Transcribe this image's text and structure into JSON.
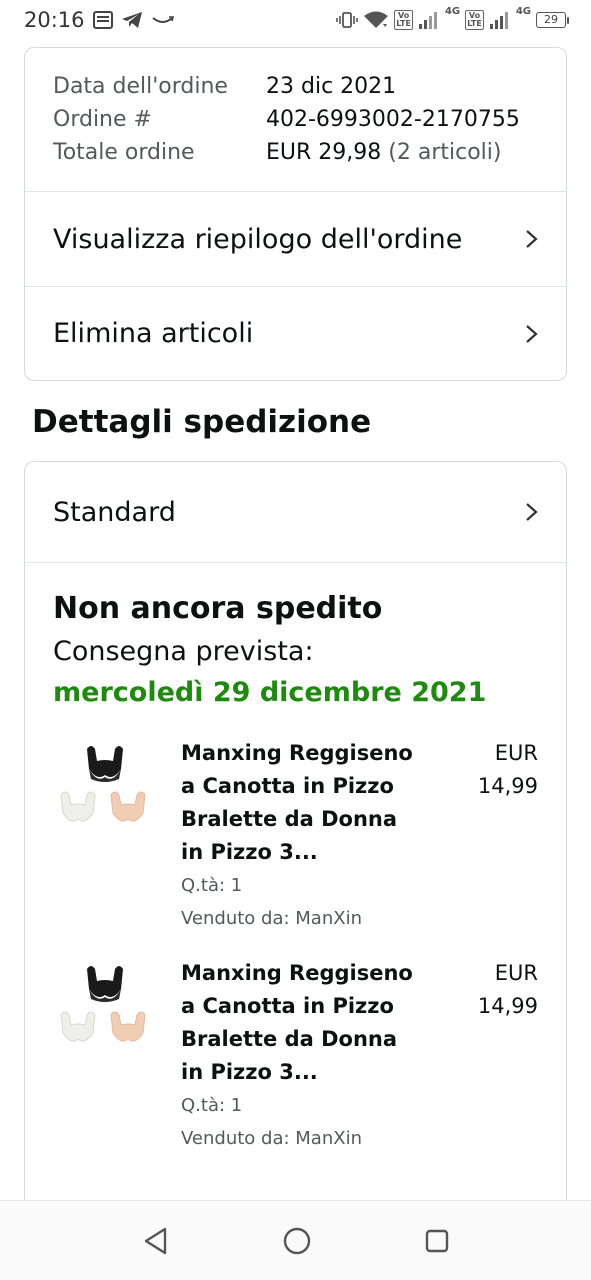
{
  "status_bar": {
    "time": "20:16",
    "icons_left": [
      "message-icon",
      "telegram-icon",
      "amazon-smile-icon"
    ],
    "icons_right": [
      "vibrate-icon",
      "wifi-icon",
      "volte-icon",
      "signal-icon",
      "4g-icon",
      "volte-icon",
      "signal-icon",
      "4g-icon",
      "battery-icon"
    ],
    "volte_label": "Vo LTE",
    "network_label": "4G",
    "battery": "29"
  },
  "order": {
    "date_label": "Data dell'ordine",
    "date_value": "23 dic 2021",
    "number_label": "Ordine #",
    "number_value": "402-6993002-2170755",
    "total_label": "Totale ordine",
    "total_value": "EUR 29,98",
    "total_items": "(2 articoli)",
    "view_summary": "Visualizza riepilogo dell'ordine",
    "delete_items": "Elimina articoli"
  },
  "shipping": {
    "section_title": "Dettagli spedizione",
    "method": "Standard",
    "status": "Non ancora spedito",
    "delivery_label": "Consegna prevista:",
    "delivery_date": "mercoledì 29 dicembre 2021",
    "accent_color": "#1e8a0e",
    "items": [
      {
        "title_lines": [
          "Manxing Reggiseno",
          "a Canotta in Pizzo",
          "Bralette da Donna",
          "in Pizzo 3..."
        ],
        "qty": "Q.tà: 1",
        "seller": "Venduto da: ManXin",
        "price_currency": "EUR",
        "price_value": "14,99"
      },
      {
        "title_lines": [
          "Manxing Reggiseno",
          "a Canotta in Pizzo",
          "Bralette da Donna",
          "in Pizzo 3..."
        ],
        "qty": "Q.tà: 1",
        "seller": "Venduto da: ManXin",
        "price_currency": "EUR",
        "price_value": "14,99"
      }
    ]
  },
  "nav_bar": {
    "buttons": [
      "back-icon",
      "home-icon",
      "recents-icon"
    ]
  }
}
